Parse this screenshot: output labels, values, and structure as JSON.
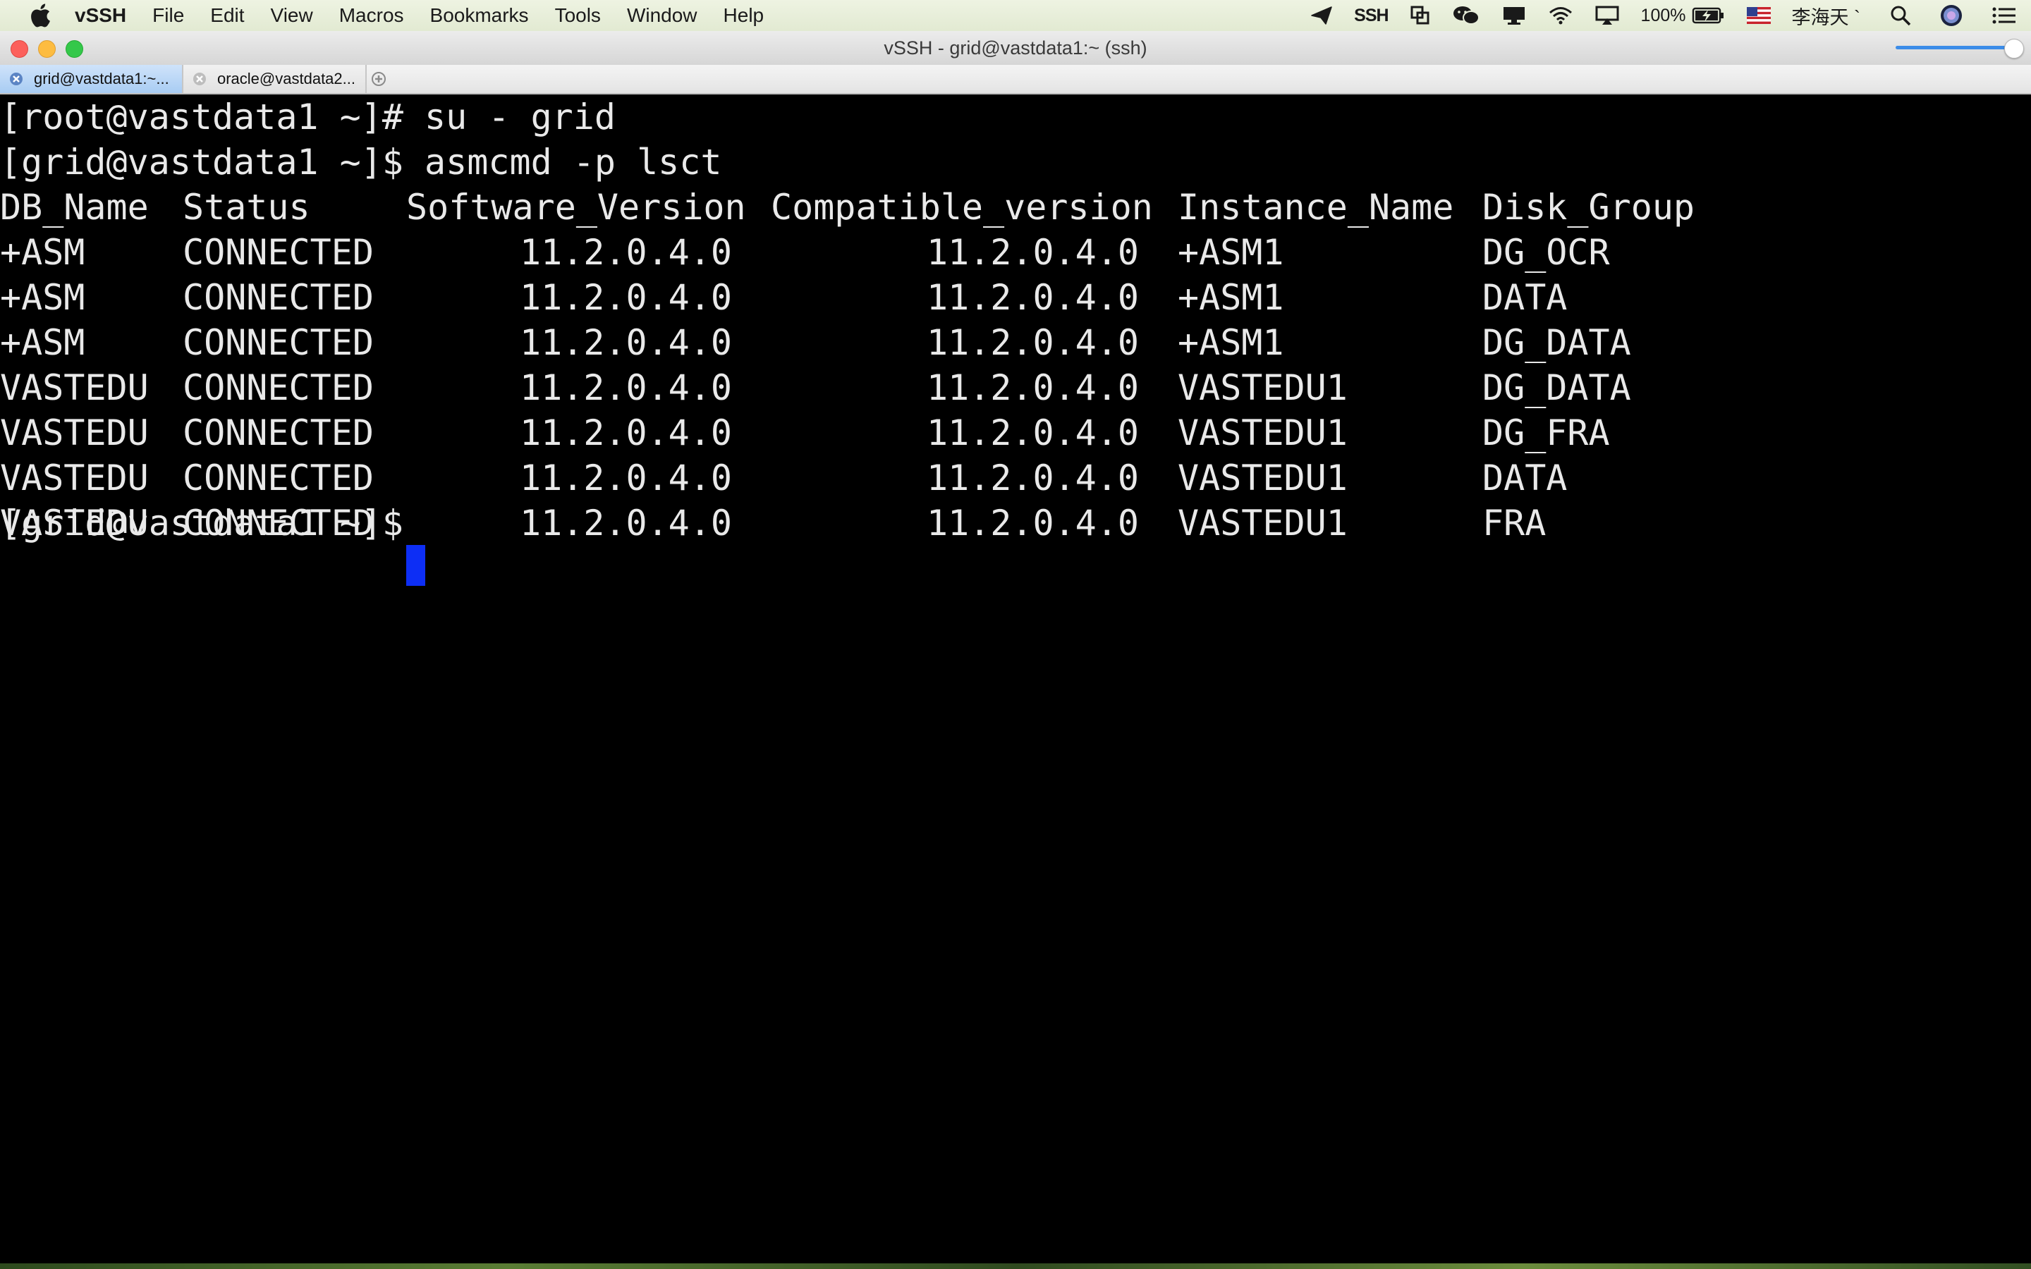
{
  "menubar": {
    "app_name": "vSSH",
    "items": [
      "File",
      "Edit",
      "View",
      "Macros",
      "Bookmarks",
      "Tools",
      "Window",
      "Help"
    ],
    "status": {
      "ssh_label": "SSH",
      "battery_percent": "100%",
      "user_name": "李海天 `",
      "icons": [
        "paper-plane-icon",
        "ssh-icon",
        "copy-icon",
        "wechat-icon",
        "monitor-icon",
        "wifi-icon",
        "airplay-icon",
        "battery-icon",
        "us-flag-icon",
        "search-icon",
        "avatar-icon",
        "list-icon"
      ]
    }
  },
  "window": {
    "title": "vSSH - grid@vastdata1:~ (ssh)"
  },
  "tabs": [
    {
      "label": "grid@vastdata1:~...",
      "active": true
    },
    {
      "label": "oracle@vastdata2...",
      "active": false
    }
  ],
  "terminal": {
    "lines": [
      "[root@vastdata1 ~]# su - grid",
      "[grid@vastdata1 ~]$ asmcmd -p lsct"
    ],
    "table": {
      "headers": [
        "DB_Name",
        "Status",
        "Software_Version",
        "Compatible_version",
        "Instance_Name",
        "Disk_Group"
      ],
      "rows": [
        [
          "+ASM",
          "CONNECTED",
          "11.2.0.4.0",
          "11.2.0.4.0",
          "+ASM1",
          "DG_OCR"
        ],
        [
          "+ASM",
          "CONNECTED",
          "11.2.0.4.0",
          "11.2.0.4.0",
          "+ASM1",
          "DATA"
        ],
        [
          "+ASM",
          "CONNECTED",
          "11.2.0.4.0",
          "11.2.0.4.0",
          "+ASM1",
          "DG_DATA"
        ],
        [
          "VASTEDU",
          "CONNECTED",
          "11.2.0.4.0",
          "11.2.0.4.0",
          "VASTEDU1",
          "DG_DATA"
        ],
        [
          "VASTEDU",
          "CONNECTED",
          "11.2.0.4.0",
          "11.2.0.4.0",
          "VASTEDU1",
          "DG_FRA"
        ],
        [
          "VASTEDU",
          "CONNECTED",
          "11.2.0.4.0",
          "11.2.0.4.0",
          "VASTEDU1",
          "DATA"
        ],
        [
          "VASTEDU",
          "CONNECTED",
          "11.2.0.4.0",
          "11.2.0.4.0",
          "VASTEDU1",
          "FRA"
        ]
      ]
    },
    "prompt": "[grid@vastdata1 ~]$ "
  },
  "colors": {
    "terminal_bg": "#000000",
    "terminal_fg": "#e9e9e9",
    "cursor": "#0d2ef5",
    "active_tab": "#b6d4f5",
    "slider": "#3c8ce8"
  }
}
